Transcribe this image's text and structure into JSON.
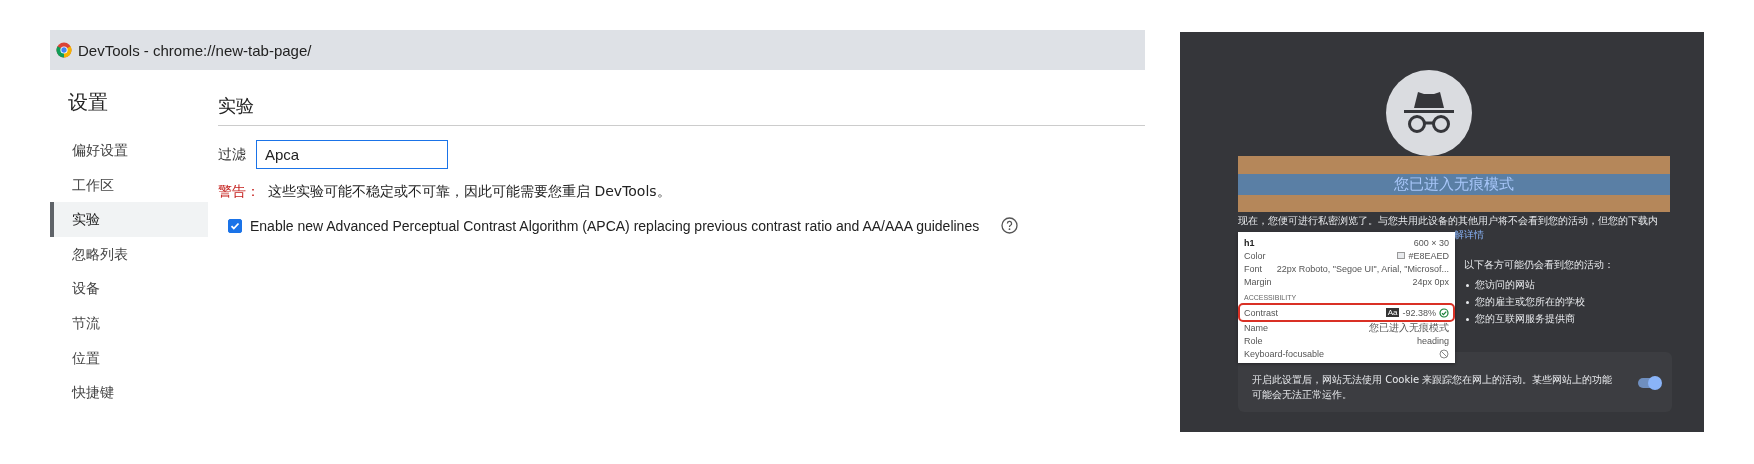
{
  "devtools": {
    "window_title": "DevTools - chrome://new-tab-page/",
    "sidebar": {
      "title": "设置",
      "items": [
        {
          "label": "偏好设置",
          "selected": false
        },
        {
          "label": "工作区",
          "selected": false
        },
        {
          "label": "实验",
          "selected": true
        },
        {
          "label": "忽略列表",
          "selected": false
        },
        {
          "label": "设备",
          "selected": false
        },
        {
          "label": "节流",
          "selected": false
        },
        {
          "label": "位置",
          "selected": false
        },
        {
          "label": "快捷键",
          "selected": false
        }
      ]
    },
    "panel": {
      "title": "实验",
      "filter": {
        "label": "过滤",
        "value": "Apca"
      },
      "warning": {
        "label": "警告：",
        "text": "这些实验可能不稳定或不可靠，因此可能需要您重启 DevTools。"
      },
      "experiments": [
        {
          "label": "Enable new Advanced Perceptual Contrast Algorithm (APCA) replacing previous contrast ratio and AA/AAA guidelines",
          "checked": true
        }
      ]
    }
  },
  "incognito_page": {
    "heading": "您已进入无痕模式",
    "intro_line": "现在，您便可进行私密浏览了。与您共用此设备的其他用户将不会看到您的活动，但您的下载内",
    "learn_more": "解详情",
    "list_title": "以下各方可能仍会看到您的活动：",
    "list": [
      "您访问的网站",
      "您的雇主或您所在的学校",
      "您的互联网服务提供商"
    ],
    "cookie_text": "开启此设置后，网站无法使用 Cookie 来跟踪您在网上的活动。某些网站上的功能可能会无法正常运作。",
    "cookie_toggle": {
      "on": true
    },
    "inspect_tooltip": {
      "tag": "h1",
      "size": "600 × 30",
      "rows": [
        {
          "label": "Color",
          "value": "#E8EAED",
          "kind": "color"
        },
        {
          "label": "Font",
          "value": "22px Roboto, \"Segoe UI\", Arial, \"Microsof...",
          "kind": "text"
        },
        {
          "label": "Margin",
          "value": "24px 0px",
          "kind": "text"
        }
      ],
      "section": "ACCESSIBILITY",
      "a11y_rows": [
        {
          "label": "Contrast",
          "sample": "Aa",
          "value": "-92.38%",
          "kind": "contrast",
          "highlighted": true
        },
        {
          "label": "Name",
          "value": "您已进入无痕模式",
          "kind": "text",
          "highlighted": false
        },
        {
          "label": "Role",
          "value": "heading",
          "kind": "text",
          "highlighted": false
        },
        {
          "label": "Keyboard-focusable",
          "kind": "not-allowed",
          "highlighted": false
        }
      ]
    }
  }
}
